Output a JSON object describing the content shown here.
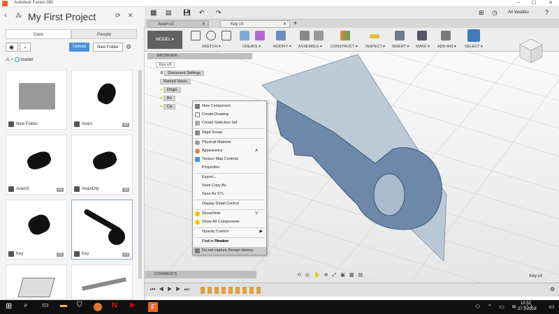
{
  "window": {
    "title": "Autodesk Fusion 360",
    "min": "─",
    "max": "☐",
    "close": "✕"
  },
  "left_panel": {
    "project_title": "My First Project",
    "tabs": [
      {
        "label": "Data"
      },
      {
        "label": "People"
      }
    ],
    "upload_label": "Upload",
    "new_folder_label": "New Folder",
    "breadcrumb": "master",
    "items": [
      {
        "name": "New Folder",
        "version": ""
      },
      {
        "name": "Avain",
        "version": "V2"
      },
      {
        "name": "Avain3",
        "version": "V4"
      },
      {
        "name": "AvainObj",
        "version": "V2"
      },
      {
        "name": "Key",
        "version": "V1"
      },
      {
        "name": "Key",
        "version": "V3"
      }
    ]
  },
  "topbar": {
    "user": "Ari Vesikko"
  },
  "doc_tabs": [
    {
      "label": "Avain v2"
    },
    {
      "label": "Key v3"
    }
  ],
  "ribbon": {
    "workspace": "MODEL ▾",
    "groups": [
      "SKETCH ▾",
      "CREATE ▾",
      "MODIFY ▾",
      "ASSEMBLE ▾",
      "CONSTRUCT ▾",
      "INSPECT ▾",
      "INSERT ▾",
      "MAKE ▾",
      "ADD-INS ▾",
      "SELECT ▾"
    ]
  },
  "browser": {
    "header": "BROWSER",
    "root": "Key v3",
    "rows": [
      "Document Settings",
      "Named Views",
      "Origin",
      "Bo",
      "Ca"
    ]
  },
  "context_menu": {
    "items": [
      {
        "label": "New Component",
        "shortcut": ""
      },
      {
        "label": "Create Drawing",
        "shortcut": ""
      },
      {
        "label": "Create Selection Set",
        "shortcut": ""
      },
      {
        "label": "Rigid Group",
        "shortcut": ""
      },
      {
        "label": "Physical Material",
        "shortcut": ""
      },
      {
        "label": "Appearance",
        "shortcut": "A"
      },
      {
        "label": "Texture Map Controls",
        "shortcut": ""
      },
      {
        "label": "Properties",
        "shortcut": ""
      },
      {
        "label": "Export...",
        "shortcut": ""
      },
      {
        "label": "Save Copy As",
        "shortcut": ""
      },
      {
        "label": "Save As STL",
        "shortcut": ""
      },
      {
        "label": "Display Detail Control",
        "shortcut": ""
      },
      {
        "label": "Show/Hide",
        "shortcut": "V"
      },
      {
        "label": "Show All Components",
        "shortcut": ""
      },
      {
        "label": "Opacity Control",
        "shortcut": ""
      },
      {
        "label": "Find in Window",
        "shortcut": ""
      },
      {
        "label": "Find in Timeline",
        "shortcut": ""
      },
      {
        "label": "Do not capture Design History",
        "shortcut": ""
      }
    ]
  },
  "comments_label": "COMMENTS",
  "viewport_label": "Key v3",
  "taskbar": {
    "time": "10.52",
    "date": "27.2.2018"
  }
}
